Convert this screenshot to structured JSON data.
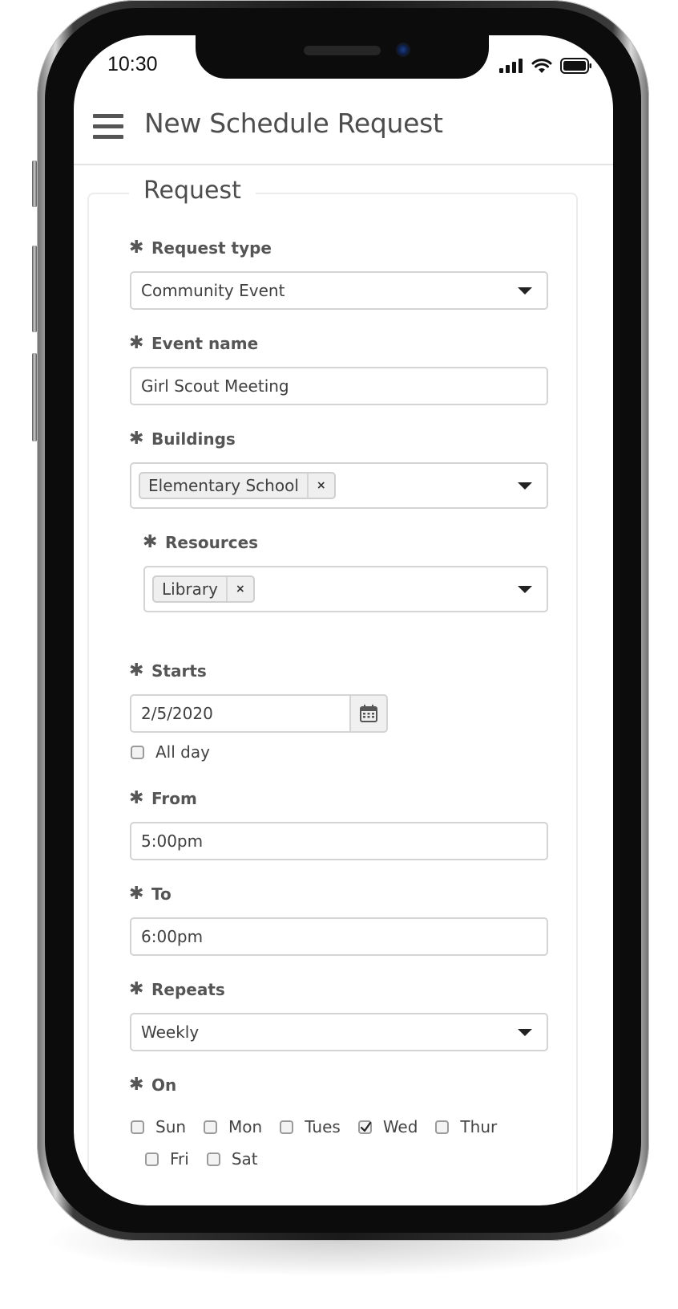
{
  "status_bar": {
    "time": "10:30"
  },
  "header": {
    "title": "New Schedule Request"
  },
  "form": {
    "legend": "Request",
    "required_marker": "✱",
    "request_type": {
      "label": "Request type",
      "value": "Community Event"
    },
    "event_name": {
      "label": "Event name",
      "value": "Girl Scout Meeting"
    },
    "buildings": {
      "label": "Buildings",
      "tags": [
        "Elementary School"
      ],
      "remove_symbol": "×"
    },
    "resources": {
      "label": "Resources",
      "tags": [
        "Library"
      ],
      "remove_symbol": "×"
    },
    "starts": {
      "label": "Starts",
      "value": "2/5/2020"
    },
    "all_day": {
      "label": "All day",
      "checked": false
    },
    "from": {
      "label": "From",
      "value": "5:00pm"
    },
    "to": {
      "label": "To",
      "value": "6:00pm"
    },
    "repeats": {
      "label": "Repeats",
      "value": "Weekly"
    },
    "on": {
      "label": "On",
      "days": [
        {
          "label": "Sun",
          "checked": false
        },
        {
          "label": "Mon",
          "checked": false
        },
        {
          "label": "Tues",
          "checked": false
        },
        {
          "label": "Wed",
          "checked": true
        },
        {
          "label": "Thur",
          "checked": false
        },
        {
          "label": "Fri",
          "checked": false
        },
        {
          "label": "Sat",
          "checked": false
        }
      ]
    }
  },
  "icons": {
    "menu": "hamburger-icon",
    "dropdown": "caret-down-icon",
    "calendar": "calendar-icon",
    "remove": "close-icon",
    "signal": "cellular-signal-icon",
    "wifi": "wifi-icon",
    "battery": "battery-icon"
  },
  "colors": {
    "text": "#4d4d4d",
    "border": "#d4d4d4",
    "tag_bg": "#efefef"
  }
}
